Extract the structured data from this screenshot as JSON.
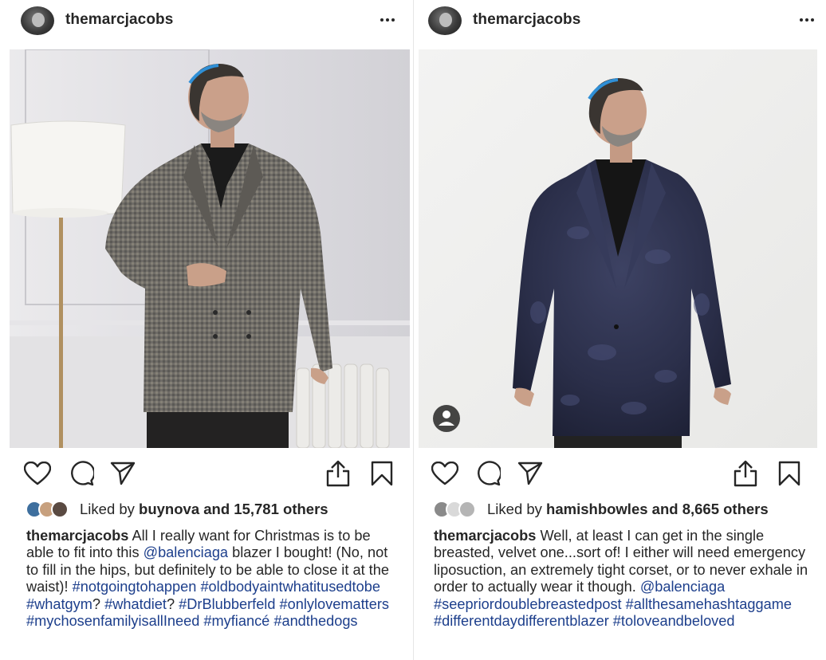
{
  "posts": [
    {
      "username": "themarcjacobs",
      "liked_by_prefix": "Liked by",
      "liked_by_user": "buynova",
      "liked_by_suffix": "and 15,781 others",
      "caption_user": "themarcjacobs",
      "caption_text_1": "All I really want for Christmas is to be able to fit into this",
      "caption_mention": "@balenciaga",
      "caption_text_2": "blazer I bought! (No, not to fill in the hips, but definitely to be able to close it at the waist)!",
      "hashtags_1": "#notgoingtohappen",
      "hashtags_2": "#oldbodyaintwhatitusedtobe #whatgym",
      "q1": "?",
      "hashtags_3": "#whatdiet",
      "q2": "?",
      "hashtags_4": "#DrBlubberfeld #onlylovematters",
      "hashtags_5": "#mychosenfamilyisallIneed #myfiancé #andthedogs"
    },
    {
      "username": "themarcjacobs",
      "liked_by_prefix": "Liked by",
      "liked_by_user": "hamishbowles",
      "liked_by_suffix": "and 8,665 others",
      "caption_user": "themarcjacobs",
      "caption_text_1": "Well, at least I can get in the single breasted, velvet one...sort of!  I either will need emergency liposuction, an extremely tight corset, or to never exhale in order to actually wear it though.",
      "caption_mention": "@balenciaga",
      "hashtags_1": "#seepriordoublebreastedpost",
      "hashtags_2": "#allthesamehashtaggame",
      "hashtags_3": "#differentdaydifferentblazer #toloveandbeloved"
    }
  ],
  "icons": {
    "like": "heart-icon",
    "comment": "comment-bubble-icon",
    "share": "paper-plane-icon",
    "upload": "upload-icon",
    "save": "bookmark-icon",
    "more": "more-dots-icon",
    "tagged": "tagged-user-icon"
  },
  "colors": {
    "hashtag": "#1d3f8c",
    "text": "#262626",
    "left_blazer": "#6e6b66",
    "right_blazer": "#2b2f4a"
  }
}
